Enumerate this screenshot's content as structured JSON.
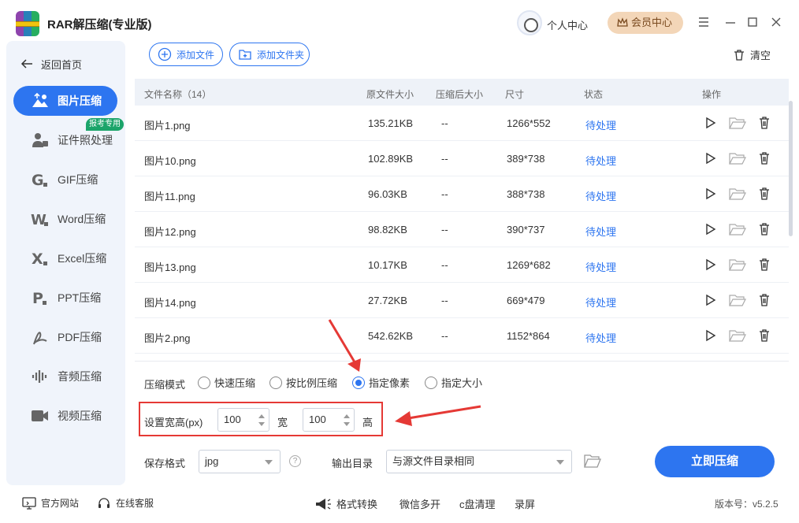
{
  "app": {
    "title": "RAR解压缩(专业版)",
    "user_center": "个人中心",
    "vip": "会员中心"
  },
  "sidebar": {
    "back": "返回首页",
    "badge": "报考专用",
    "items": [
      {
        "label": "图片压缩",
        "icon": "image-icon"
      },
      {
        "label": "证件照处理",
        "icon": "id-photo-icon"
      },
      {
        "label": "GIF压缩",
        "icon": "gif-icon"
      },
      {
        "label": "Word压缩",
        "icon": "word-icon"
      },
      {
        "label": "Excel压缩",
        "icon": "excel-icon"
      },
      {
        "label": "PPT压缩",
        "icon": "ppt-icon"
      },
      {
        "label": "PDF压缩",
        "icon": "pdf-icon"
      },
      {
        "label": "音频压缩",
        "icon": "audio-icon"
      },
      {
        "label": "视频压缩",
        "icon": "video-icon"
      }
    ]
  },
  "toolbar": {
    "add_file": "添加文件",
    "add_folder": "添加文件夹",
    "clear": "清空"
  },
  "table": {
    "headers": {
      "name": "文件名称（14）",
      "orig": "原文件大小",
      "comp": "压缩后大小",
      "size": "尺寸",
      "status": "状态",
      "ops": "操作"
    },
    "rows": [
      {
        "name": "图片1.png",
        "orig": "135.21KB",
        "comp": "--",
        "size": "1266*552",
        "status": "待处理"
      },
      {
        "name": "图片10.png",
        "orig": "102.89KB",
        "comp": "--",
        "size": "389*738",
        "status": "待处理"
      },
      {
        "name": "图片11.png",
        "orig": "96.03KB",
        "comp": "--",
        "size": "388*738",
        "status": "待处理"
      },
      {
        "name": "图片12.png",
        "orig": "98.82KB",
        "comp": "--",
        "size": "390*737",
        "status": "待处理"
      },
      {
        "name": "图片13.png",
        "orig": "10.17KB",
        "comp": "--",
        "size": "1269*682",
        "status": "待处理"
      },
      {
        "name": "图片14.png",
        "orig": "27.72KB",
        "comp": "--",
        "size": "669*479",
        "status": "待处理"
      },
      {
        "name": "图片2.png",
        "orig": "542.62KB",
        "comp": "--",
        "size": "1152*864",
        "status": "待处理"
      }
    ]
  },
  "settings": {
    "mode_label": "压缩模式",
    "modes": [
      "快速压缩",
      "按比例压缩",
      "指定像素",
      "指定大小"
    ],
    "selected_mode": "指定像素",
    "dims_label": "设置宽高(px)",
    "width": "100",
    "width_label": "宽",
    "height": "100",
    "height_label": "高",
    "format_label": "保存格式",
    "format": "jpg",
    "help": "?",
    "output_label": "输出目录",
    "output": "与源文件目录相同",
    "start": "立即压缩"
  },
  "footer": {
    "website": "官方网站",
    "service": "在线客服",
    "format_convert": "格式转换",
    "wechat": "微信多开",
    "c_clean": "c盘清理",
    "record": "录屏",
    "version": "版本号：v5.2.5"
  },
  "colors": {
    "accent": "#2d75f0",
    "annotation": "#e53935",
    "sidebar_bg": "#f0f4fb"
  }
}
